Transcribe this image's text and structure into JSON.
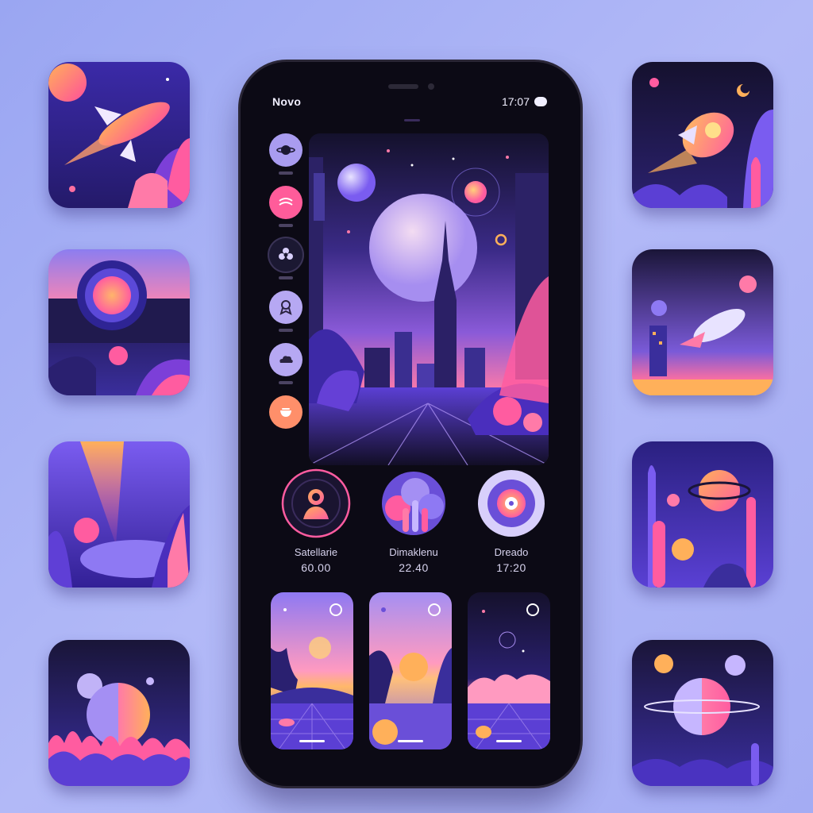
{
  "status_bar": {
    "carrier": "Novo",
    "time": "17:07"
  },
  "main_menu": {
    "items": [
      {
        "icon": "planet-icon",
        "color": "#a99cf0"
      },
      {
        "icon": "music-icon",
        "color": "#ff5c9a"
      },
      {
        "icon": "flower-icon",
        "color": "#1b1832"
      },
      {
        "icon": "ribbon-icon",
        "color": "#b6a8f3"
      },
      {
        "icon": "cloud-icon",
        "color": "#b6a8f3"
      },
      {
        "icon": "bowl-icon",
        "color": "#ff8f6a"
      }
    ]
  },
  "stats": [
    {
      "name": "Satellarie",
      "value": "60.00",
      "icon": "avatar-icon"
    },
    {
      "name": "Dimaklenu",
      "value": "22.40",
      "icon": "mushroom-icon"
    },
    {
      "name": "Dreado",
      "value": "17:20",
      "icon": "vinyl-icon"
    }
  ],
  "colors": {
    "accent": "#ff5c9a",
    "accent_orange": "#ffb25a",
    "purple": "#7b5cf0",
    "bg": "#0c0a15"
  }
}
